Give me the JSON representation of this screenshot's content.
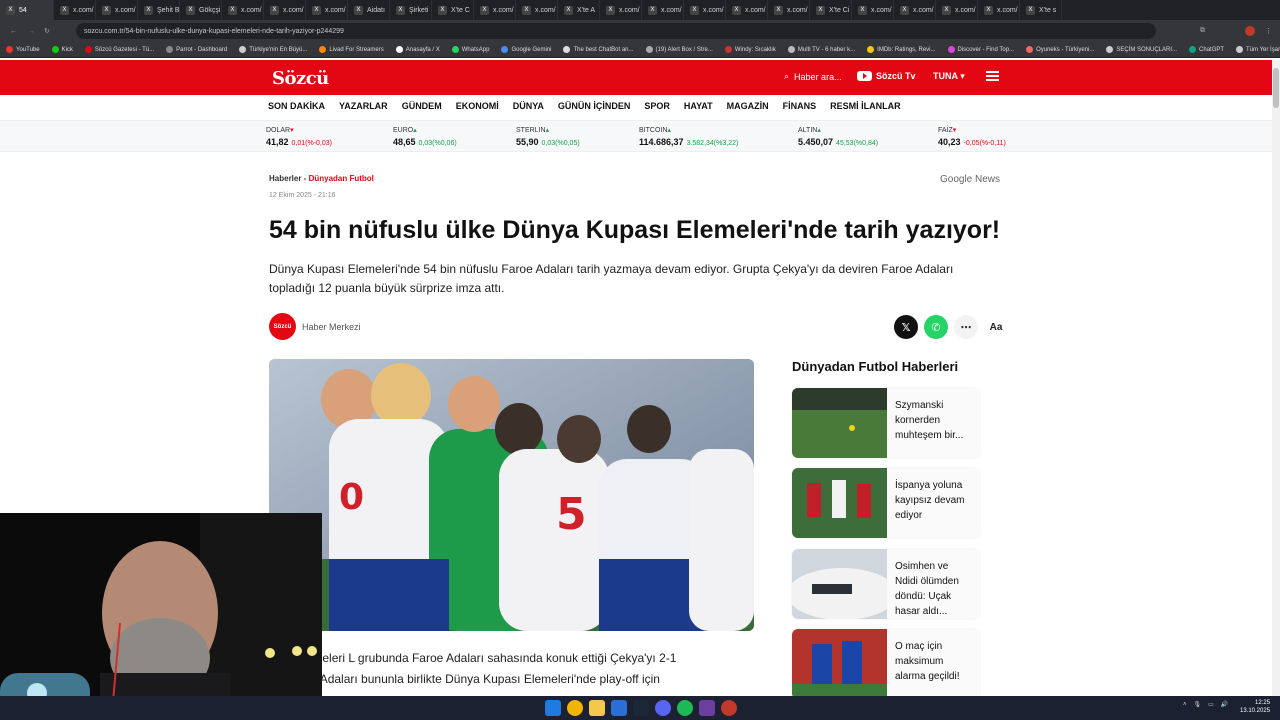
{
  "browser": {
    "tabs": [
      {
        "label": "54",
        "active": true
      },
      {
        "label": "x.com/"
      },
      {
        "label": "x.com/"
      },
      {
        "label": "Şehit B"
      },
      {
        "label": "Gökçşi"
      },
      {
        "label": "x.com/"
      },
      {
        "label": "x.com/"
      },
      {
        "label": "x.com/"
      },
      {
        "label": "Aidatı"
      },
      {
        "label": "Şirketi"
      },
      {
        "label": "X'te C"
      },
      {
        "label": "x.com/"
      },
      {
        "label": "x.com/"
      },
      {
        "label": "X'te A"
      },
      {
        "label": "x.com/"
      },
      {
        "label": "x.com/"
      },
      {
        "label": "x.com/"
      },
      {
        "label": "x.com/"
      },
      {
        "label": "x.com/"
      },
      {
        "label": "X'te Ci"
      },
      {
        "label": "x.com/"
      },
      {
        "label": "x.com/"
      },
      {
        "label": "x.com/"
      },
      {
        "label": "x.com/"
      },
      {
        "label": "X'te s"
      }
    ],
    "url": "sozcu.com.tr/54-bin-nufuslu-ulke-dunya-kupasi-elemeleri-nde-tarih-yaziyor-p244299",
    "bookmarks": [
      "YouTube",
      "Kick",
      "Sözcü Gazetesi - Tü...",
      "Parrot - Dashboard",
      "Türkiye'nin En Büyü...",
      "Livad For Streamers",
      "Anasayfa / X",
      "WhatsApp",
      "Google Gemini",
      "The best ChatBot an...",
      "(19) Alert Box / Stre...",
      "Windy: Sıcaklık",
      "Multi TV - 6 haber k...",
      "IMDb: Ratings, Revi...",
      "Discover - Find Top...",
      "Oyuneks - Türkiyeni...",
      "SEÇİM SONUÇLARI...",
      "ChatGPT",
      "Tüm Yer İşaretleri"
    ]
  },
  "header": {
    "logo": "Sözcü",
    "search_placeholder": "Haber ara...",
    "tv_label": "Sözcü Tv",
    "user": "TUNA"
  },
  "nav": [
    "SON DAKİKA",
    "YAZARLAR",
    "GÜNDEM",
    "EKONOMİ",
    "DÜNYA",
    "GÜNÜN İÇİNDEN",
    "SPOR",
    "HAYAT",
    "MAGAZİN",
    "FİNANS",
    "RESMİ İLANLAR"
  ],
  "markets": [
    {
      "name": "DOLAR",
      "dir": "down",
      "value": "41,82",
      "change": "0,01(%-0,03)"
    },
    {
      "name": "EURO",
      "dir": "up",
      "value": "48,65",
      "change": "0,03(%0,06)"
    },
    {
      "name": "STERLIN",
      "dir": "up",
      "value": "55,90",
      "change": "0,03(%0,05)"
    },
    {
      "name": "BITCOIN",
      "dir": "up",
      "value": "114.686,37",
      "change": "3.582,34(%3,22)"
    },
    {
      "name": "ALTIN",
      "dir": "up",
      "value": "5.450,07",
      "change": "45,53(%0,84)"
    },
    {
      "name": "FAİZ",
      "dir": "down",
      "value": "40,23",
      "change": "-0,05(%-0,11)"
    }
  ],
  "article": {
    "breadcrumb_root": "Haberler",
    "breadcrumb_sep": " - ",
    "category": "Dünyadan Futbol",
    "google_news": "Google News",
    "date": "12 Ekim 2025 - 21:16",
    "title": "54 bin nüfuslu ülke Dünya Kupası Elemeleri'nde tarih yazıyor!",
    "lead": "Dünya Kupası Elemeleri'nde 54 bin nüfuslu Faroe Adaları tarih yazmaya devam ediyor. Grupta Çekya'yı da deviren Faroe Adaları topladığı 12 puanla büyük sürprize imza attı.",
    "author": "Haber Merkezi",
    "author_avatar_text": "Sözcü",
    "body_line1": "pası Elemeleri L grubunda Faroe Adaları sahasında konuk ettiği Çekya'yı 2-1",
    "body_line2": "ttı. Faroe Adaları bununla birlikte Dünya Kupası Elemeleri'nde play-off için"
  },
  "sidebar": {
    "title": "Dünyadan Futbol Haberleri",
    "items": [
      {
        "title": "Szymanski kornerden muhteşem bir..."
      },
      {
        "title": "İspanya yoluna kayıpsız devam ediyor"
      },
      {
        "title": "Osimhen ve Ndidi ölümden döndü: Uçak hasar aldı..."
      },
      {
        "title": "O maç için maksimum alarma geçildi!"
      }
    ]
  },
  "taskbar": {
    "time": "12:25",
    "date": "13.10.2025"
  },
  "colors": {
    "brand": "#e30613",
    "up": "#1a9e4a",
    "down": "#e30613"
  }
}
